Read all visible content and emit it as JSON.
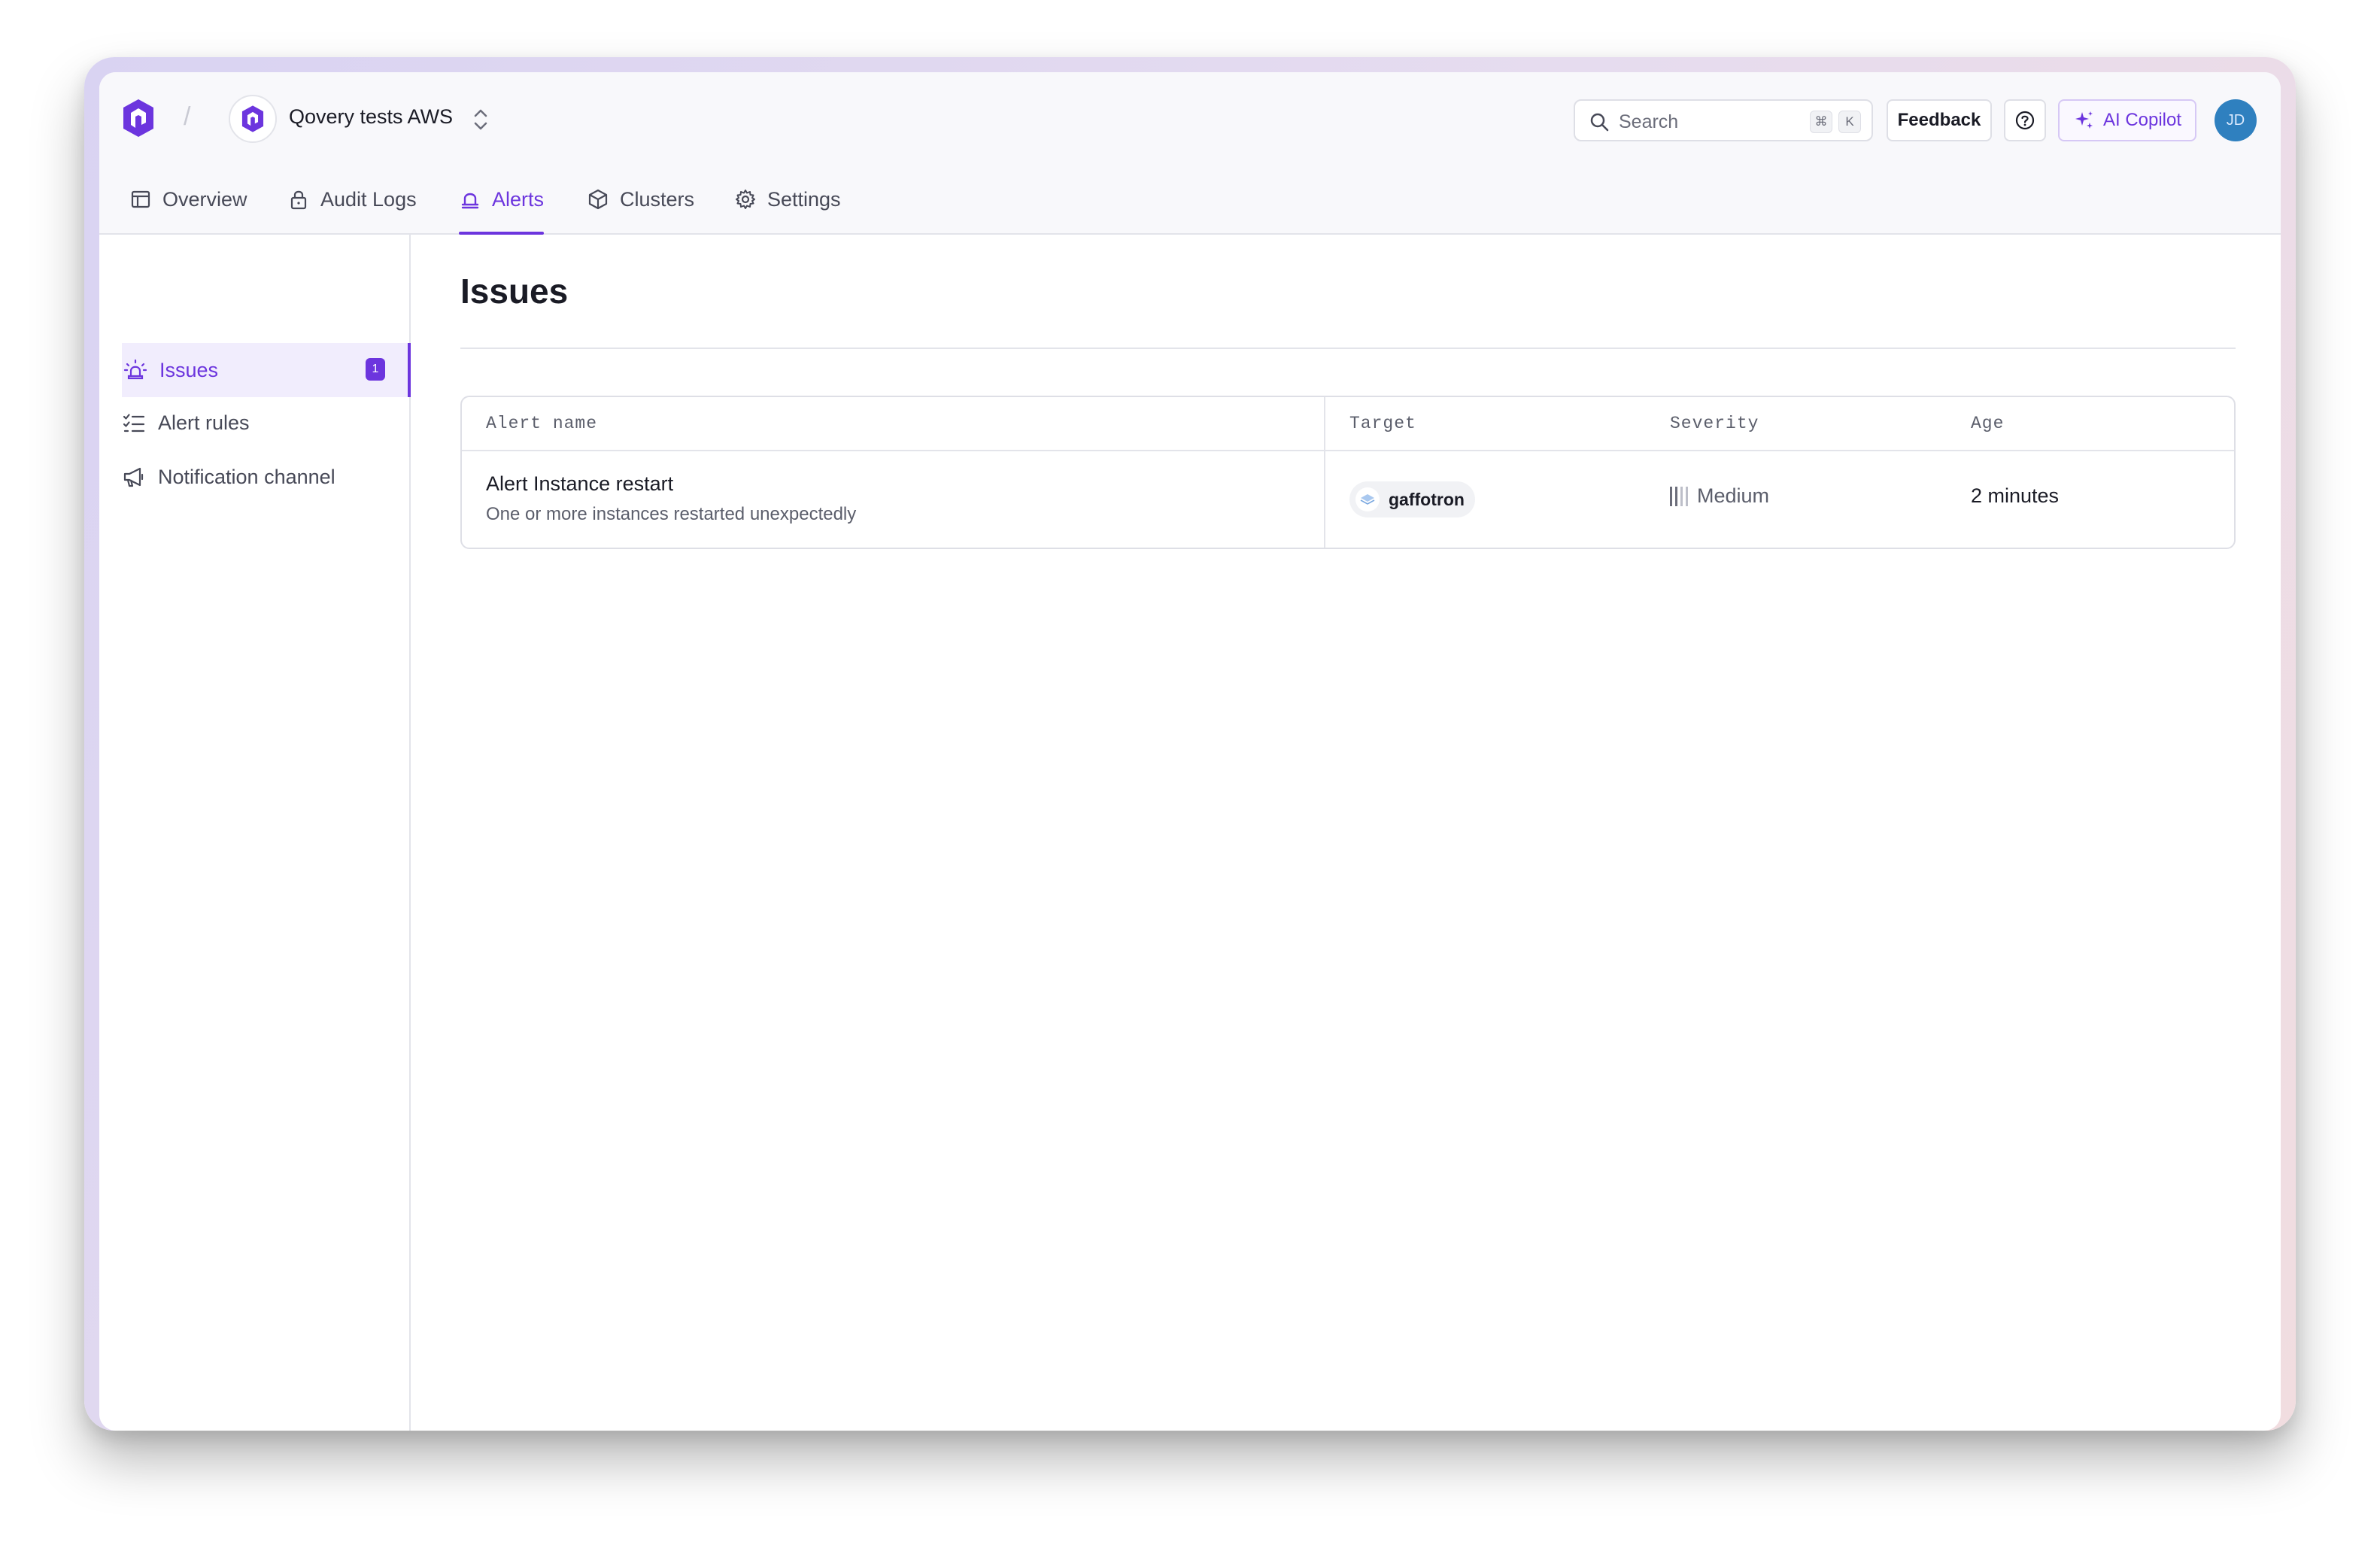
{
  "header": {
    "org_name": "Qovery tests AWS",
    "breadcrumb_separator": "/",
    "search": {
      "label": "Search",
      "shortcut_mod": "⌘",
      "shortcut_key": "K"
    },
    "feedback_label": "Feedback",
    "copilot_label": "AI Copilot",
    "user_initials": "JD"
  },
  "tabs": [
    {
      "label": "Overview",
      "icon": "layout-icon"
    },
    {
      "label": "Audit Logs",
      "icon": "lock-icon"
    },
    {
      "label": "Alerts",
      "icon": "bell-icon",
      "active": true
    },
    {
      "label": "Clusters",
      "icon": "cube-icon"
    },
    {
      "label": "Settings",
      "icon": "gear-icon"
    }
  ],
  "sidebar": {
    "items": [
      {
        "label": "Issues",
        "icon": "siren-icon",
        "badge": "1",
        "active": true
      },
      {
        "label": "Alert rules",
        "icon": "list-checks-icon"
      },
      {
        "label": "Notification channel",
        "icon": "megaphone-icon"
      }
    ]
  },
  "main": {
    "title": "Issues",
    "table": {
      "columns": [
        "Alert name",
        "Target",
        "Severity",
        "Age"
      ],
      "rows": [
        {
          "name": "Alert Instance restart",
          "description": "One or more instances restarted unexpectedly",
          "target": "gaffotron",
          "severity": "Medium",
          "severity_level": 2,
          "severity_max": 4,
          "age": "2 minutes"
        }
      ]
    }
  },
  "colors": {
    "accent": "#6c35de",
    "avatar": "#2f80bf"
  }
}
